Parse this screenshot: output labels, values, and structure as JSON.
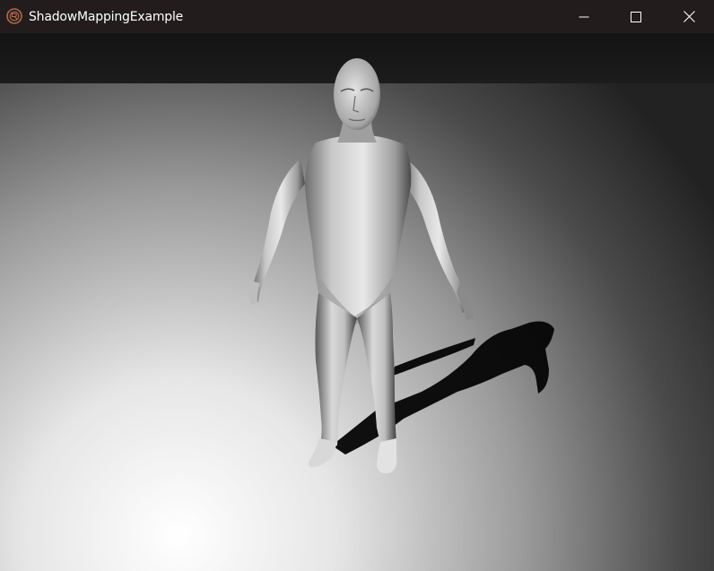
{
  "window": {
    "title": "ShadowMappingExample",
    "app_icon": "raylib-logo-icon",
    "controls": {
      "minimize_icon": "minimize-icon",
      "maximize_icon": "maximize-icon",
      "close_icon": "close-icon"
    }
  },
  "scene": {
    "subject": "human-figure-model",
    "floor_color_near": "#f6f6f6",
    "floor_color_far": "#2a2a2a",
    "sky_color": "#121212"
  },
  "colors": {
    "titlebar": "#221c1c",
    "title_text": "#ffffff"
  }
}
